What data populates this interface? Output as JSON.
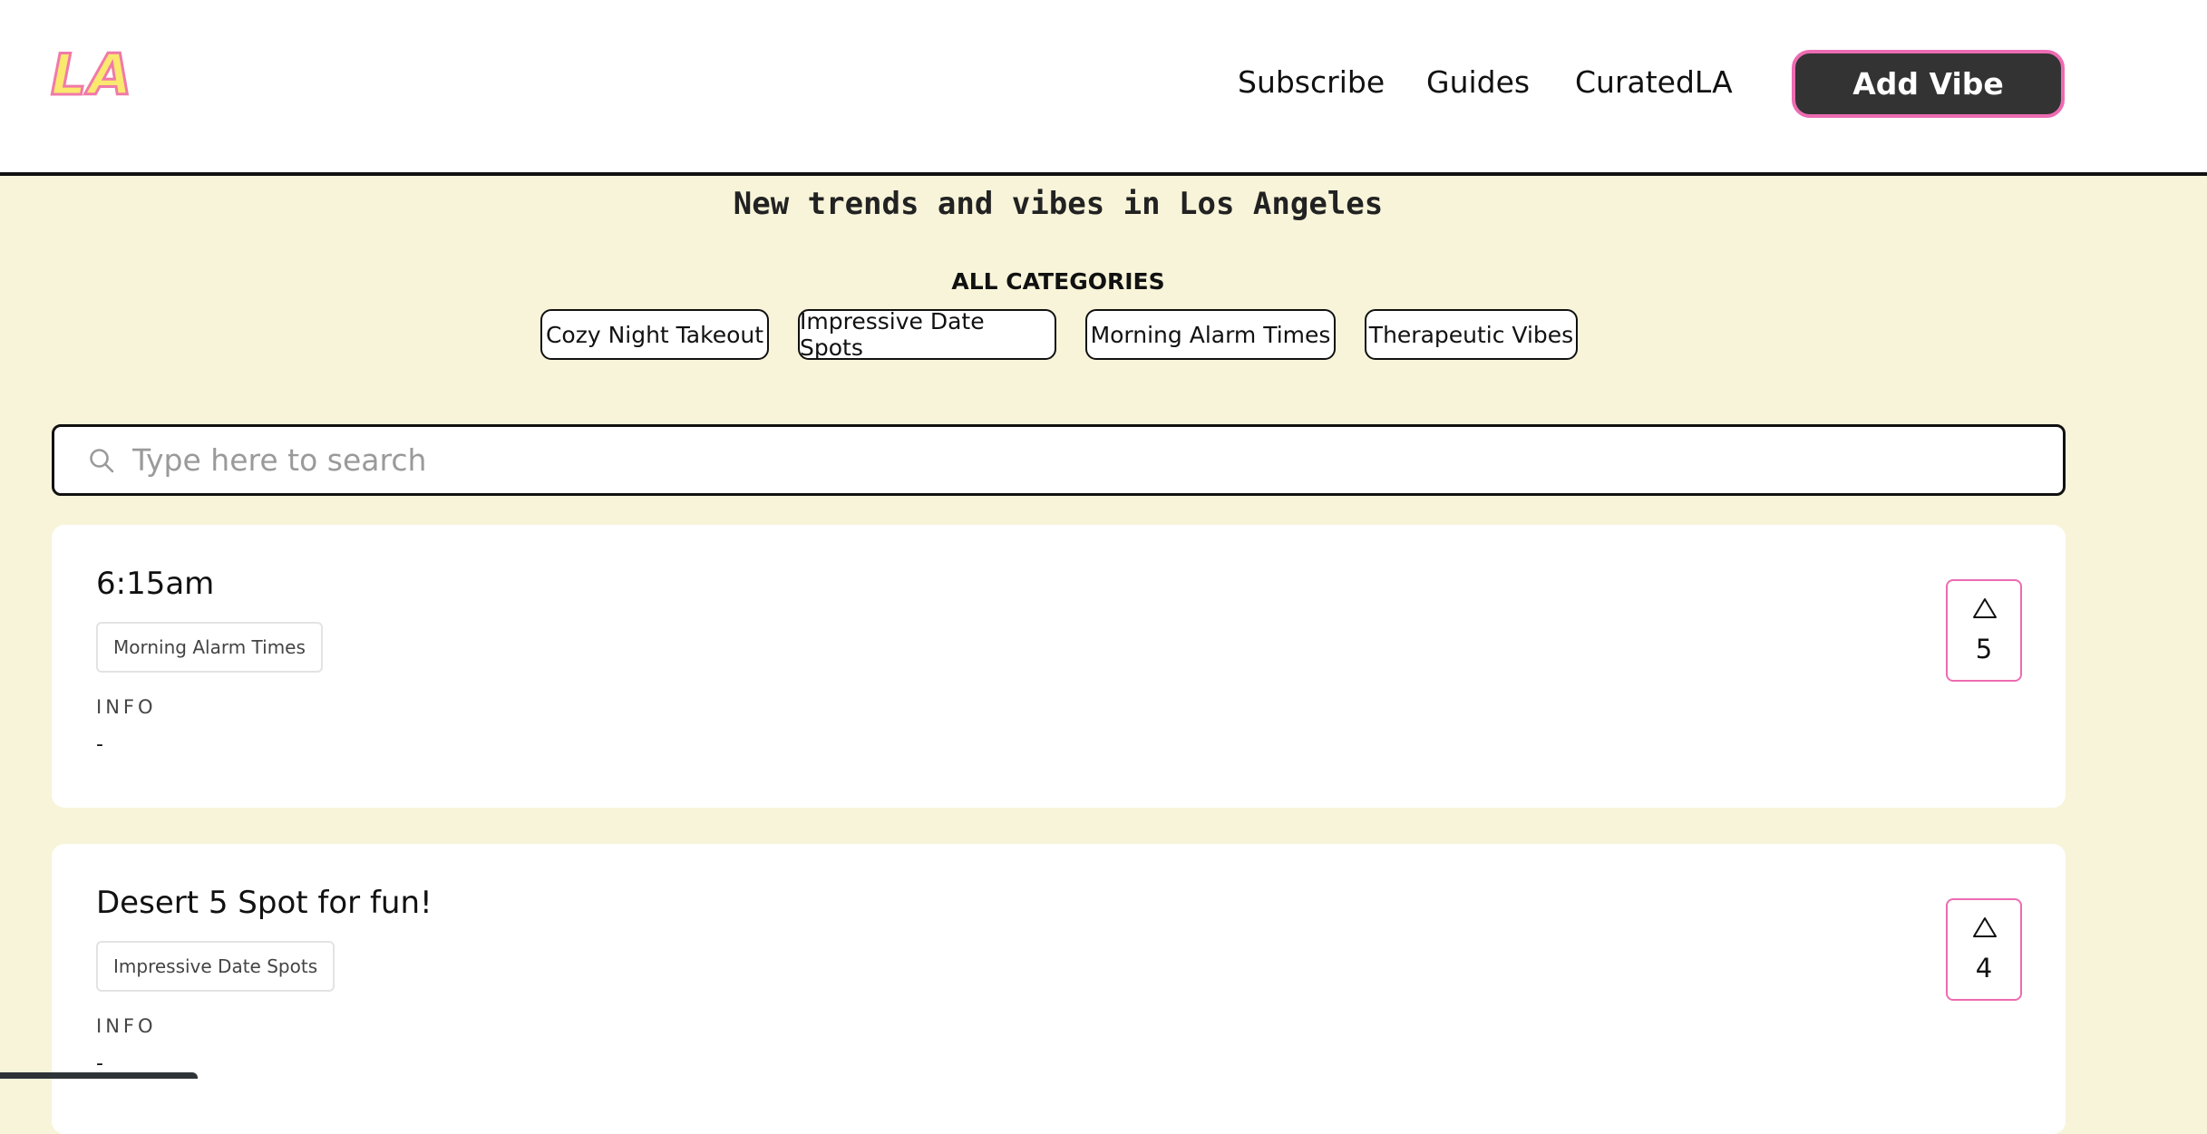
{
  "header": {
    "logo_text": "LA",
    "nav": {
      "subscribe": "Subscribe",
      "guides": "Guides",
      "curated": "CuratedLA"
    },
    "add_button": "Add Vibe"
  },
  "hero": {
    "tagline": "New trends and vibes in Los Angeles",
    "categories_heading": "ALL CATEGORIES",
    "categories": [
      "Cozy Night Takeout",
      "Impressive Date Spots",
      "Morning Alarm Times",
      "Therapeutic Vibes"
    ]
  },
  "search": {
    "placeholder": "Type here to search",
    "value": ""
  },
  "posts": [
    {
      "title": "6:15am",
      "category": "Morning Alarm Times",
      "info_label": "INFO",
      "info": "-",
      "votes": "5"
    },
    {
      "title": "Desert 5 Spot for fun!",
      "category": "Impressive Date Spots",
      "info_label": "INFO",
      "info": "-",
      "votes": "4"
    }
  ],
  "colors": {
    "background": "#f7f4d9",
    "accent_pink": "#ec6cb2",
    "logo_yellow": "#fbe86f",
    "button_dark": "#333333"
  },
  "icons": {
    "search": "search-icon",
    "upvote": "triangle-up-icon"
  }
}
